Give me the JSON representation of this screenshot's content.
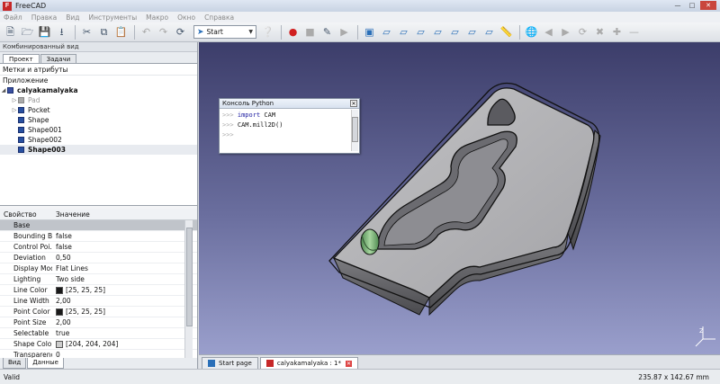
{
  "window": {
    "title": "FreeCAD",
    "logo_text": "F"
  },
  "menu": [
    "Файл",
    "Правка",
    "Вид",
    "Инструменты",
    "Макро",
    "Окно",
    "Справка"
  ],
  "toolbar": {
    "workbench": "Start",
    "icons": [
      "new-file-icon",
      "open-file-icon",
      "save-icon",
      "save-as-icon",
      "cut-icon",
      "copy-icon",
      "paste-icon",
      "undo-icon",
      "redo-icon",
      "refresh-icon",
      "whats-this-icon",
      "record-macro-icon",
      "stop-macro-icon",
      "edit-macro-icon",
      "run-macro-icon",
      "fit-all-icon",
      "axonometric-view-icon",
      "front-view-icon",
      "top-view-icon",
      "right-view-icon",
      "rear-view-icon",
      "bottom-view-icon",
      "left-view-icon",
      "measure-icon",
      "web-icon",
      "back-icon",
      "forward-icon",
      "reload-icon",
      "stop-icon",
      "zoom-in-icon",
      "zoom-out-icon"
    ]
  },
  "combo_view": {
    "title": "Комбинированный вид",
    "tabs": [
      "Проект",
      "Задачи"
    ],
    "tree_header": "Метки и атрибуты",
    "section": "Приложение",
    "document": "calyakamalyaka",
    "items": [
      "Pad",
      "Pocket",
      "Shape",
      "Shape001",
      "Shape002",
      "Shape003"
    ]
  },
  "properties": {
    "header": [
      "Свойство",
      "Значение"
    ],
    "group": "Base",
    "rows": [
      {
        "k": "Bounding Box",
        "v": "false"
      },
      {
        "k": "Control Poi...",
        "v": "false"
      },
      {
        "k": "Deviation",
        "v": "0,50"
      },
      {
        "k": "Display Mode",
        "v": "Flat Lines"
      },
      {
        "k": "Lighting",
        "v": "Two side"
      },
      {
        "k": "Line Color",
        "v": "[25, 25, 25]",
        "color": "#191919"
      },
      {
        "k": "Line Width",
        "v": "2,00"
      },
      {
        "k": "Point Color",
        "v": "[25, 25, 25]",
        "color": "#191919"
      },
      {
        "k": "Point Size",
        "v": "2,00"
      },
      {
        "k": "Selectable",
        "v": "true"
      },
      {
        "k": "Shape Color",
        "v": "[204, 204, 204]",
        "color": "#cccccc"
      },
      {
        "k": "Transparency",
        "v": "0"
      }
    ],
    "bottom_tabs": [
      "Вид",
      "Данные"
    ]
  },
  "console": {
    "title": "Консоль Python",
    "prompt": ">>>",
    "lines": [
      {
        "kw": "import",
        "rest": " CAM"
      },
      {
        "kw": "",
        "rest": "CAM.mill2D()"
      }
    ]
  },
  "document_tabs": [
    "Start page",
    "calyakamalyaka : 1*"
  ],
  "status": {
    "left": "Valid",
    "coords": "235.87 x 142.67 mm"
  },
  "axis_labels": {
    "x": "X",
    "y": "Y",
    "z": "Z"
  },
  "colors": {
    "model_face": "#b5b5b8",
    "viewport_top": "#3c3d6a",
    "viewport_bottom": "#9a9fcc",
    "selected_cylinder": "#7fb07a"
  }
}
